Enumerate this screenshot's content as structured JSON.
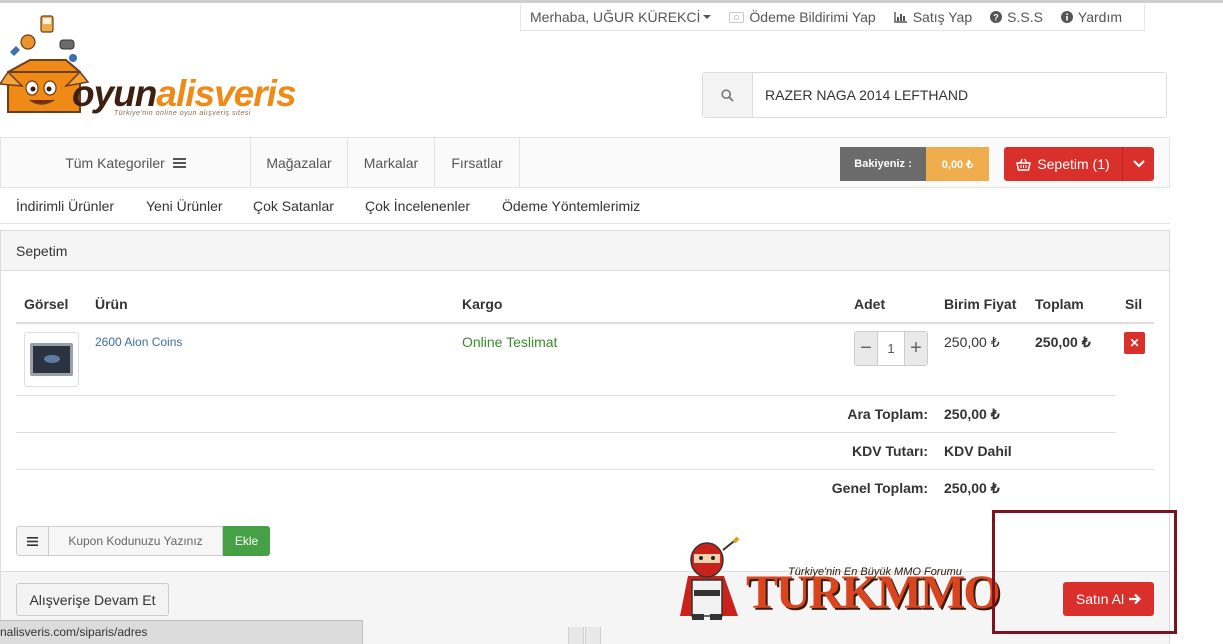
{
  "topbar": {
    "greeting": "Merhaba, UĞUR KÜREKCİ",
    "payment_notice": "Ödeme Bildirimi Yap",
    "sell": "Satış Yap",
    "faq": "S.S.S",
    "help": "Yardım"
  },
  "logo": {
    "part1": "oyun",
    "part2": "alisveris",
    "tagline": "Türkiye'nin online oyun alışveriş sitesi"
  },
  "search": {
    "value": "RAZER NAGA 2014 LEFTHAND"
  },
  "mainnav": {
    "all_categories": "Tüm Kategoriler",
    "stores": "Mağazalar",
    "brands": "Markalar",
    "deals": "Fırsatlar",
    "balance_label": "Bakiyeniz :",
    "balance_value": "0,00 ₺",
    "cart_label": "Sepetim (1)"
  },
  "subnav": {
    "items": [
      "İndirimli Ürünler",
      "Yeni Ürünler",
      "Çok Satanlar",
      "Çok İncelenenler",
      "Ödeme Yöntemlerimiz"
    ]
  },
  "cart": {
    "title": "Sepetim",
    "columns": {
      "image": "Görsel",
      "product": "Ürün",
      "shipping": "Kargo",
      "quantity": "Adet",
      "unit_price": "Birim Fiyat",
      "total": "Toplam",
      "delete": "Sil"
    },
    "items": [
      {
        "product": "2600 Aion Coins",
        "shipping": "Online Teslimat",
        "quantity": "1",
        "unit_price": "250,00 ₺",
        "total": "250,00 ₺"
      }
    ],
    "summary": {
      "subtotal_label": "Ara Toplam:",
      "subtotal_value": "250,00 ₺",
      "vat_label": "KDV Tutarı:",
      "vat_value": "KDV Dahil",
      "grand_label": "Genel Toplam:",
      "grand_value": "250,00 ₺"
    },
    "coupon_placeholder": "Kupon Kodunuzu Yazınız",
    "coupon_add": "Ekle",
    "continue_shopping": "Alışverişe Devam Et",
    "buy": "Satın Al"
  },
  "watermark": {
    "tagline": "Türkiye'nin En Büyük MMO Forumu",
    "brand": "TURKMMO"
  },
  "statusbar": {
    "url": "nalisveris.com/siparis/adres"
  },
  "colors": {
    "accent_red": "#d9302b",
    "balance_orange": "#f0ad4e",
    "coupon_green": "#46a046",
    "link_blue": "#3a6ea5",
    "highlight_border": "#7a1520"
  }
}
